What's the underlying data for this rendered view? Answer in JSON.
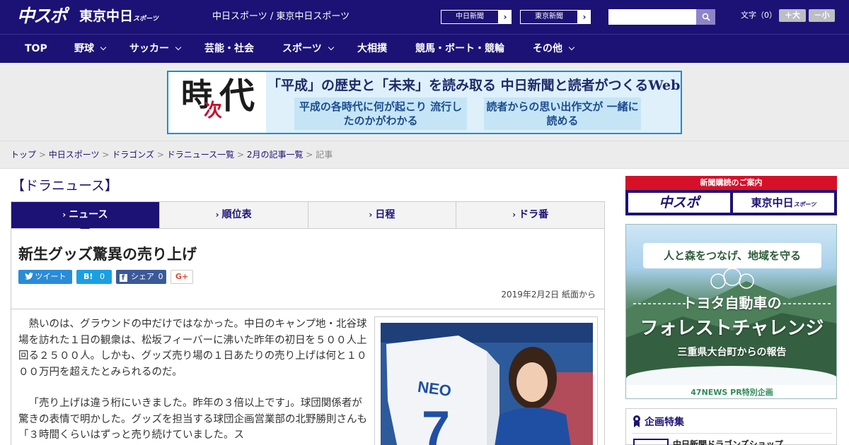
{
  "header": {
    "logo_chusupo": "中スポ",
    "logo_tokyo": "東京中日",
    "logo_tokyo_sub": "スポーツ",
    "site_title": "中日スポーツ / 東京中日スポーツ",
    "paper_buttons": [
      "中日新聞",
      "東京新聞"
    ],
    "search_placeholder": "",
    "font_label": "文字（0）",
    "font_larger": "＋大",
    "font_smaller": "－小"
  },
  "nav": {
    "items": [
      {
        "label": "TOP",
        "dropdown": false
      },
      {
        "label": "野球",
        "dropdown": true
      },
      {
        "label": "サッカー",
        "dropdown": true
      },
      {
        "label": "芸能・社会",
        "dropdown": false
      },
      {
        "label": "スポーツ",
        "dropdown": true
      },
      {
        "label": "大相撲",
        "dropdown": false
      },
      {
        "label": "競馬・ボート・競輪",
        "dropdown": false
      },
      {
        "label": "その他",
        "dropdown": true
      }
    ]
  },
  "banner": {
    "kanji_1": "時",
    "kanji_2": "次",
    "kanji_3": "代",
    "headline": "「平成」の歴史と「未来」を読み取る 中日新聞と読者がつくるWebサイト",
    "sub_left": "平成の各時代に何が起こり 流行したのかがわかる",
    "sub_right": "読者からの思い出作文が 一緒に読める"
  },
  "breadcrumb": {
    "items": [
      "トップ",
      "中日スポーツ",
      "ドラゴンズ",
      "ドラニュース一覧",
      "2月の記事一覧"
    ],
    "current": "記事",
    "separator": ">"
  },
  "section": {
    "title": "【ドラニュース】"
  },
  "tabs": [
    {
      "label": "ニュース",
      "active": true
    },
    {
      "label": "順位表",
      "active": false
    },
    {
      "label": "日程",
      "active": false
    },
    {
      "label": "ドラ番",
      "active": false
    }
  ],
  "article": {
    "title": "新生グッズ驚異の売り上げ",
    "share": {
      "tweet": "ツイート",
      "hatena_label": "B!",
      "hatena_count": "0",
      "facebook_label": "シェア",
      "facebook_count": "0",
      "gplus": "G+"
    },
    "date": "2019年2月2日 紙面から",
    "paragraphs": [
      "熱いのは、グラウンドの中だけではなかった。中日のキャンプ地・北谷球場を訪れた１日の観衆は、松坂フィーバーに沸いた昨年の初日を５００人上回る２５００人。しかも、グッズ売り場の１日あたりの売り上げは何と１０００万円を超えたとみられるのだ。",
      "「売り上げは違う桁にいきました。昨年の３倍以上です」。球団関係者が驚きの表情で明かした。グッズを担当する球団企画営業部の北野勝則さんも「３時間くらいはずっと売り続けていました。ス"
    ],
    "photo_jersey_text": "NEO",
    "photo_jersey_number": "7"
  },
  "sidebar": {
    "ad1_title": "新聞購読のご案内",
    "ad1_left": "中スポ",
    "ad1_right": "東京中日",
    "ad1_right_sub": "スポーツ",
    "ad2_ribbon": "人と森をつなげ、地域を守る",
    "ad2_line1": "トヨタ自動車の",
    "ad2_line2": "フォレストチャレンジ",
    "ad2_line3": "三重県大台町からの報告",
    "ad2_footer": "47NEWS PR特別企画",
    "feature_title": "企画特集",
    "feature_item": "中日新聞ドラゴンズショップ"
  },
  "colors": {
    "brand_navy": "#1c1275",
    "accent_red": "#d7102a",
    "twitter": "#2a8bd8",
    "hatena": "#1aa0e0",
    "facebook": "#3b5998"
  }
}
